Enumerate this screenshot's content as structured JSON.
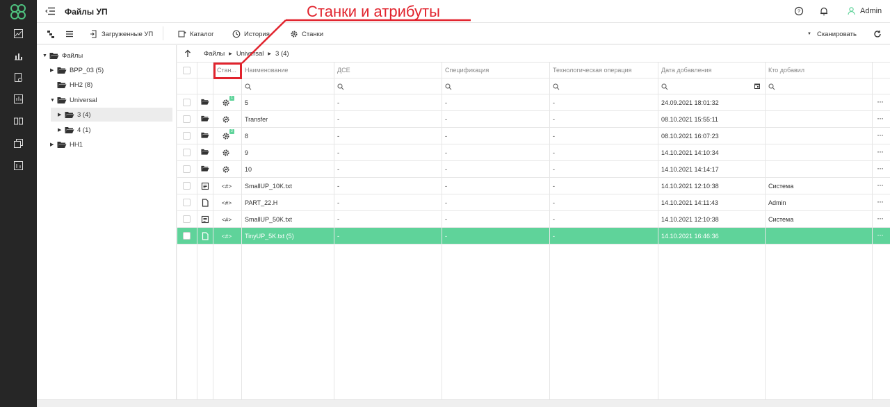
{
  "header": {
    "title": "Файлы УП",
    "user": "Admin"
  },
  "toolbar": {
    "loaded": "Загруженные УП",
    "catalog": "Каталог",
    "history": "История",
    "machines": "Станки",
    "scan": "Сканировать"
  },
  "tree": {
    "root": "Файлы",
    "items": [
      "BPP_03 (5)",
      "HH2 (8)",
      "Universal",
      "3 (4)",
      "4 (1)",
      "HH1"
    ]
  },
  "breadcrumb": [
    "Файлы",
    "Universal",
    "3 (4)"
  ],
  "table": {
    "headers": [
      "Стан...",
      "Наименование",
      "ДСЕ",
      "Спецификация",
      "Технологическая операция",
      "Дата добавления",
      "Кто добавил"
    ],
    "rows": [
      {
        "kind": "folder",
        "badge": "1",
        "name": "5",
        "dse": "-",
        "spec": "-",
        "op": "-",
        "date": "24.09.2021 18:01:32",
        "who": ""
      },
      {
        "kind": "folder",
        "badge": "",
        "name": "Transfer",
        "dse": "-",
        "spec": "-",
        "op": "-",
        "date": "08.10.2021 15:55:11",
        "who": ""
      },
      {
        "kind": "folder",
        "badge": "2",
        "name": "8",
        "dse": "-",
        "spec": "-",
        "op": "-",
        "date": "08.10.2021 16:07:23",
        "who": ""
      },
      {
        "kind": "folder",
        "badge": "",
        "name": "9",
        "dse": "-",
        "spec": "-",
        "op": "-",
        "date": "14.10.2021 14:10:34",
        "who": ""
      },
      {
        "kind": "folder",
        "badge": "",
        "name": "10",
        "dse": "-",
        "spec": "-",
        "op": "-",
        "date": "14.10.2021 14:14:17",
        "who": ""
      },
      {
        "kind": "textfile",
        "badge": "",
        "name": "SmallUP_10K.txt",
        "dse": "-",
        "spec": "-",
        "op": "-",
        "date": "14.10.2021 12:10:38",
        "who": "Система"
      },
      {
        "kind": "file",
        "badge": "",
        "name": "PART_22.H",
        "dse": "-",
        "spec": "-",
        "op": "-",
        "date": "14.10.2021 14:11:43",
        "who": "Admin"
      },
      {
        "kind": "textfile",
        "badge": "",
        "name": "SmallUP_50K.txt",
        "dse": "-",
        "spec": "-",
        "op": "-",
        "date": "14.10.2021 12:10:38",
        "who": "Система"
      },
      {
        "kind": "file",
        "badge": "",
        "name": "TinyUP_5K.txt (5)",
        "dse": "-",
        "spec": "-",
        "op": "-",
        "date": "14.10.2021 16:46:36",
        "who": ""
      }
    ],
    "selected_row": 8
  },
  "annotation": {
    "text": "Станки и атрибуты",
    "color": "#e1232d"
  },
  "colors": {
    "accent": "#5fd39a",
    "rail": "#262626"
  }
}
